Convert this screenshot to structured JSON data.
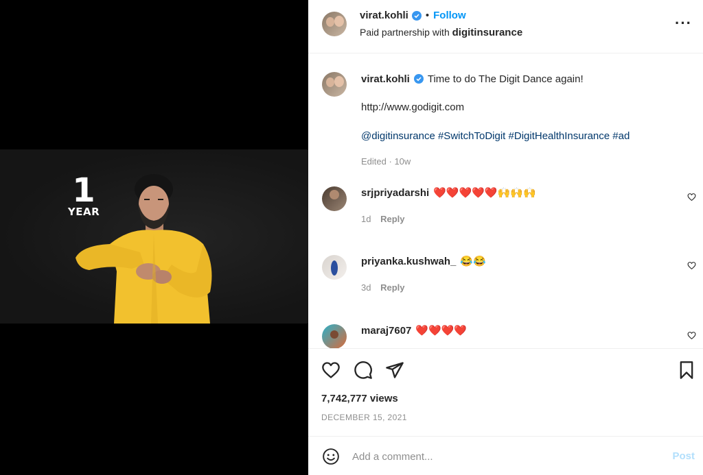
{
  "media": {
    "badge_number": "1",
    "badge_unit": "YEAR"
  },
  "header": {
    "username": "virat.kohli",
    "follow_label": "Follow",
    "partnership_prefix": "Paid partnership with",
    "partner_name": "digitinsurance",
    "more_icon": "more-horizontal-icon"
  },
  "caption": {
    "username": "virat.kohli",
    "text": "Time to do The Digit Dance again!",
    "link": "http://www.godigit.com",
    "tags": [
      "@digitinsurance",
      "#SwitchToDigit",
      "#DigitHealthInsurance",
      "#ad"
    ],
    "edited": "Edited",
    "time": "10w"
  },
  "comments": [
    {
      "username": "srjpriyadarshi",
      "text": "❤️❤️❤️❤️❤️🙌🙌🙌",
      "time": "1d",
      "reply": "Reply"
    },
    {
      "username": "priyanka.kushwah_",
      "text": "😂😂",
      "time": "3d",
      "reply": "Reply"
    },
    {
      "username": "maraj7607",
      "text": "❤️❤️❤️❤️",
      "time": "",
      "reply": ""
    }
  ],
  "stats": {
    "views": "7,742,777 views",
    "date": "DECEMBER 15, 2021"
  },
  "composer": {
    "placeholder": "Add a comment...",
    "post_label": "Post"
  },
  "colors": {
    "accent": "#0095f6",
    "link": "#00376b",
    "muted": "#8e8e8e",
    "verified": "#3897f0",
    "sweater": "#f2c12e"
  }
}
